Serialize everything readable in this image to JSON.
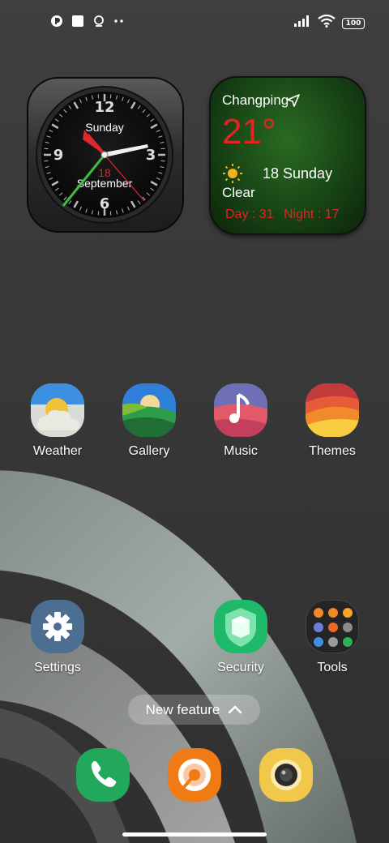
{
  "status_bar": {
    "battery": "100",
    "left_icons": [
      "notification-app-icon",
      "square-notification-icon",
      "location-pin-icon",
      "more-dots-icon"
    ],
    "right_icons": [
      "signal-icon",
      "wifi-icon",
      "battery-icon"
    ]
  },
  "clock_widget": {
    "day": "Sunday",
    "date": "18",
    "month": "September",
    "numerals": [
      "12",
      "3",
      "6",
      "9"
    ]
  },
  "weather_widget": {
    "city": "Changping",
    "temperature": "21°",
    "date": "18 Sunday",
    "condition": "Clear",
    "day_temp": "Day : 31",
    "night_temp": "Night : 17",
    "icons": [
      "location-arrow-icon",
      "sun-icon"
    ]
  },
  "apps_row1": [
    {
      "label": "Weather",
      "icon": "weather-icon"
    },
    {
      "label": "Gallery",
      "icon": "gallery-icon"
    },
    {
      "label": "Music",
      "icon": "music-icon"
    },
    {
      "label": "Themes",
      "icon": "themes-icon"
    }
  ],
  "apps_row2": [
    {
      "label": "Settings",
      "icon": "gear-icon"
    },
    {
      "label": "Security",
      "icon": "shield-icon"
    },
    {
      "label": "Tools",
      "icon": "folder-icon"
    }
  ],
  "new_feature": {
    "label": "New feature",
    "icon": "chevron-up-icon"
  },
  "dock": [
    {
      "icon": "phone-icon"
    },
    {
      "icon": "browser-icon"
    },
    {
      "icon": "camera-icon"
    }
  ],
  "colors": {
    "background": "#3a3a3a",
    "weather_red": "#e32424",
    "clock_accent": "#e0282b"
  }
}
